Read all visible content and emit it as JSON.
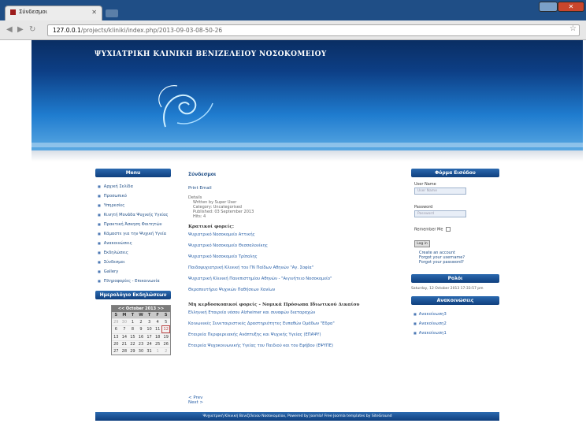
{
  "browser": {
    "tab_title": "Σύνδεσμοι",
    "url_host": "127.0.0.1",
    "url_path": "/projects/kliniki/index.php/2013-09-03-08-50-26"
  },
  "site": {
    "title": "ΨΥΧΙΑΤΡΙΚΗ ΚΛΙΝΙΚΗ ΒΕΝΙΖΕΛΕΙΟΥ ΝΟΣΟΚΟΜΕΙΟΥ"
  },
  "menu": {
    "title": "Menu",
    "items": [
      "Αρχική Σελίδα",
      "Προσωπικό",
      "Υπηρεσίες",
      "Κινητή Μονάδα Ψυχικής Υγείας",
      "Πρακτική Άσκηση Φοιτητών",
      "Κάμαστε για την Ψυχική Υγεία",
      "Ανακοινώσεις",
      "Εκδηλώσεις",
      "Σύνδεσμοι",
      "Gallery",
      "Πληροφορίες - Επικοινωνία"
    ]
  },
  "calendar": {
    "title": "Ημερολόγιο Εκδηλώσεων",
    "month": "October 2013",
    "prev": "<<",
    "next": ">>",
    "dow": [
      "S",
      "M",
      "T",
      "W",
      "T",
      "F",
      "S"
    ],
    "days": [
      "29",
      "30",
      "1",
      "2",
      "3",
      "4",
      "5",
      "6",
      "7",
      "8",
      "9",
      "10",
      "11",
      "12",
      "13",
      "14",
      "15",
      "16",
      "17",
      "18",
      "19",
      "20",
      "21",
      "22",
      "23",
      "24",
      "25",
      "26",
      "27",
      "28",
      "29",
      "30",
      "31",
      "1",
      "2"
    ]
  },
  "content": {
    "title": "Σύνδεσμοι",
    "print_email": "Print  Email",
    "details_label": "Details",
    "written_by": "Written by Super User",
    "category": "Category: Uncategorised",
    "published": "Published: 03 September 2013",
    "hits": "Hits: 4",
    "section1_title": "Κρατικοί φορείς:",
    "section1_links": [
      "Ψυχιατρικό Νοσοκομείο Αττικής",
      "Ψυχιατρικό Νοσοκομείο Θεσσαλονίκης",
      "Ψυχιατρικό Νοσοκομείο Τρίπολης",
      "Παιδοψυχιατρική Κλινική του ΓΝ Παίδων Αθηνών \"Αγ. Σοφία\"",
      "Ψυχιατρική Κλινική Πανεπιστημίου Αθηνών - \"Αιγινήτειο Νοσοκομείο\"",
      "Θεραπευτήριο Ψυχικών Παθήσεων Χανίων"
    ],
    "section2_title": "Μη κερδοσκοπικοί φορείς - Νομικά Πρόσωπα Ιδιωτικού Δικαίου",
    "section2_links": [
      "Ελληνική Εταιρεία νόσου Alzheimer και συναφών διαταραχών",
      "Κοινωνικές Συνεταιριστικές Δραστηριότητες Ευπαθών Ομάδων \"Εδρα\"",
      "Εταιρεία Περιφερειακής Ανάπτυξης και Ψυχικής Υγείας (ΕΠΑΨΥ)",
      "Εταιρεία Ψυχοκοινωνικής Υγείας του Παιδιού και του Εφήβου (ΕΨΥΠΕ)"
    ],
    "prev": "< Prev",
    "next": "Next >"
  },
  "login": {
    "title": "Φόρμα Εισόδου",
    "username_label": "User Name",
    "username_placeholder": "User Name",
    "password_label": "Password",
    "password_placeholder": "Password",
    "remember_label": "Remember Me",
    "login_button": "Log in",
    "links": [
      "Create an account",
      "Forgot your username?",
      "Forgot your password?"
    ]
  },
  "clock": {
    "title": "Ρολόι",
    "datetime": "Saturday, 12 October 2013 17:33:57 pm"
  },
  "announcements": {
    "title": "Ανακοινώσεις",
    "items": [
      "Ανακοίνωση3",
      "Ανακοίνωση2",
      "Ανακοίνωση1"
    ]
  },
  "footer": {
    "text": "Ψυχιατρική Κλινική Βενιζέλειου Νοσοκομείου, Powered by Joomla! Free Joomla templates by SiteGround"
  }
}
